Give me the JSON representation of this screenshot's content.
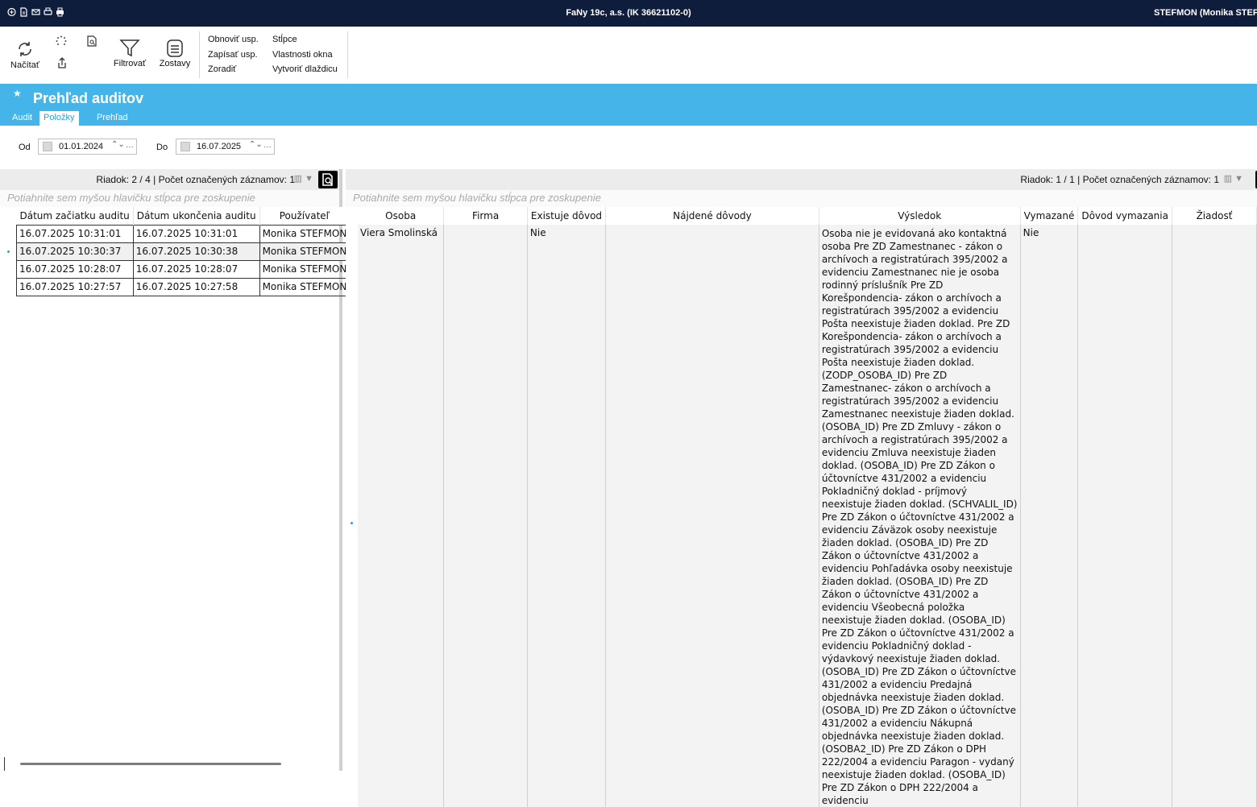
{
  "titlebar": {
    "title": "FaNy 19c, a.s. (IK 36621102-0)",
    "user": "STEFMON (Monika STEF",
    "quick_icons": [
      "app-icon",
      "document-icon",
      "mail-icon",
      "print-preview-icon",
      "print-icon"
    ]
  },
  "ribbon": {
    "load_label": "Načítať",
    "filter_label": "Filtrovať",
    "reports_label": "Zostavy",
    "refresh_prefs": "Obnoviť usp.",
    "save_prefs": "Zapísať usp.",
    "sort": "Zoradiť",
    "columns": "Stĺpce",
    "window_props": "Vlastnosti okna",
    "create_tile": "Vytvoriť dlaždicu"
  },
  "header": {
    "title": "Prehľad auditov",
    "tabs": [
      {
        "label": "Audit",
        "active": false
      },
      {
        "label": "Položky",
        "active": true
      },
      {
        "label": "Prehľad",
        "active": false
      }
    ]
  },
  "filters": {
    "from_label": "Od",
    "from_value": "01.01.2024",
    "to_label": "Do",
    "to_value": "16.07.2025"
  },
  "left": {
    "status": "Riadok: 2 / 4 | Počet označených záznamov: 1",
    "group_hint": "Potiahnite sem myšou hlavičku stĺpca pre zoskupenie",
    "columns": [
      "Dátum začiatku auditu",
      "Dátum ukončenia auditu",
      "Používateľ"
    ],
    "rows": [
      [
        "16.07.2025 10:31:01",
        "16.07.2025 10:31:01",
        "Monika STEFMON"
      ],
      [
        "16.07.2025 10:30:37",
        "16.07.2025 10:30:38",
        "Monika STEFMON"
      ],
      [
        "16.07.2025 10:28:07",
        "16.07.2025 10:28:07",
        "Monika STEFMON"
      ],
      [
        "16.07.2025 10:27:57",
        "16.07.2025 10:27:58",
        "Monika STEFMON"
      ]
    ]
  },
  "right": {
    "status": "Riadok: 1 / 1 | Počet označených záznamov: 1",
    "group_hint": "Potiahnite sem myšou hlavičku stĺpca pre zoskupenie",
    "columns": [
      "Osoba",
      "Firma",
      "Existuje dôvod",
      "Nájdené dôvody",
      "Výsledok",
      "Vymazané",
      "Dôvod vymazania",
      "Žiadosť"
    ],
    "row": {
      "osoba": "Viera Smolinská",
      "firma": "",
      "existuje": "Nie",
      "najdene": "",
      "vysledok": "Osoba nie je evidovaná ako kontaktná osoba Pre ZD Zamestnanec - zákon o archívoch a registratúrach 395/2002 a evidenciu Zamestnanec nie je osoba rodinný príslušník Pre ZD Korešpondencia- zákon o archívoch a registratúrach 395/2002 a evidenciu Pošta neexistuje žiaden doklad. Pre ZD Korešpondencia- zákon o archívoch a registratúrach 395/2002 a evidenciu Pošta neexistuje žiaden doklad. (ZODP_OSOBA_ID) Pre ZD Zamestnanec- zákon o archívoch a registratúrach 395/2002 a evidenciu Zamestnanec neexistuje žiaden doklad. (OSOBA_ID) Pre ZD Zmluvy - zákon o archívoch a registratúrach 395/2002 a evidenciu Zmluva neexistuje žiaden doklad. (OSOBA_ID) Pre ZD Zákon o účtovníctve 431/2002 a evidenciu Pokladničný doklad - príjmový neexistuje žiaden doklad. (SCHVALIL_ID) Pre ZD Zákon o účtovníctve 431/2002 a evidenciu Záväzok osoby neexistuje žiaden doklad. (OSOBA_ID) Pre ZD Zákon o účtovníctve 431/2002 a evidenciu Pohľadávka osoby neexistuje žiaden doklad. (OSOBA_ID) Pre ZD Zákon o účtovníctve 431/2002 a evidenciu Všeobecná položka neexistuje žiaden doklad. (OSOBA_ID) Pre ZD Zákon o účtovníctve 431/2002 a evidenciu Pokladničný doklad - výdavkový neexistuje žiaden doklad. (OSOBA_ID) Pre ZD Zákon o účtovníctve 431/2002 a evidenciu Predajná objednávka neexistuje žiaden doklad. (OSOBA_ID) Pre ZD Zákon o účtovníctve 431/2002 a evidenciu Nákupná objednávka neexistuje žiaden doklad. (OSOBA2_ID) Pre ZD Zákon o DPH 222/2004 a evidenciu Paragon - vydaný neexistuje žiaden doklad. (OSOBA_ID) Pre ZD Zákon o DPH 222/2004 a evidenciu",
      "vymazane": "Nie",
      "dovod": "",
      "ziadost": ""
    }
  }
}
